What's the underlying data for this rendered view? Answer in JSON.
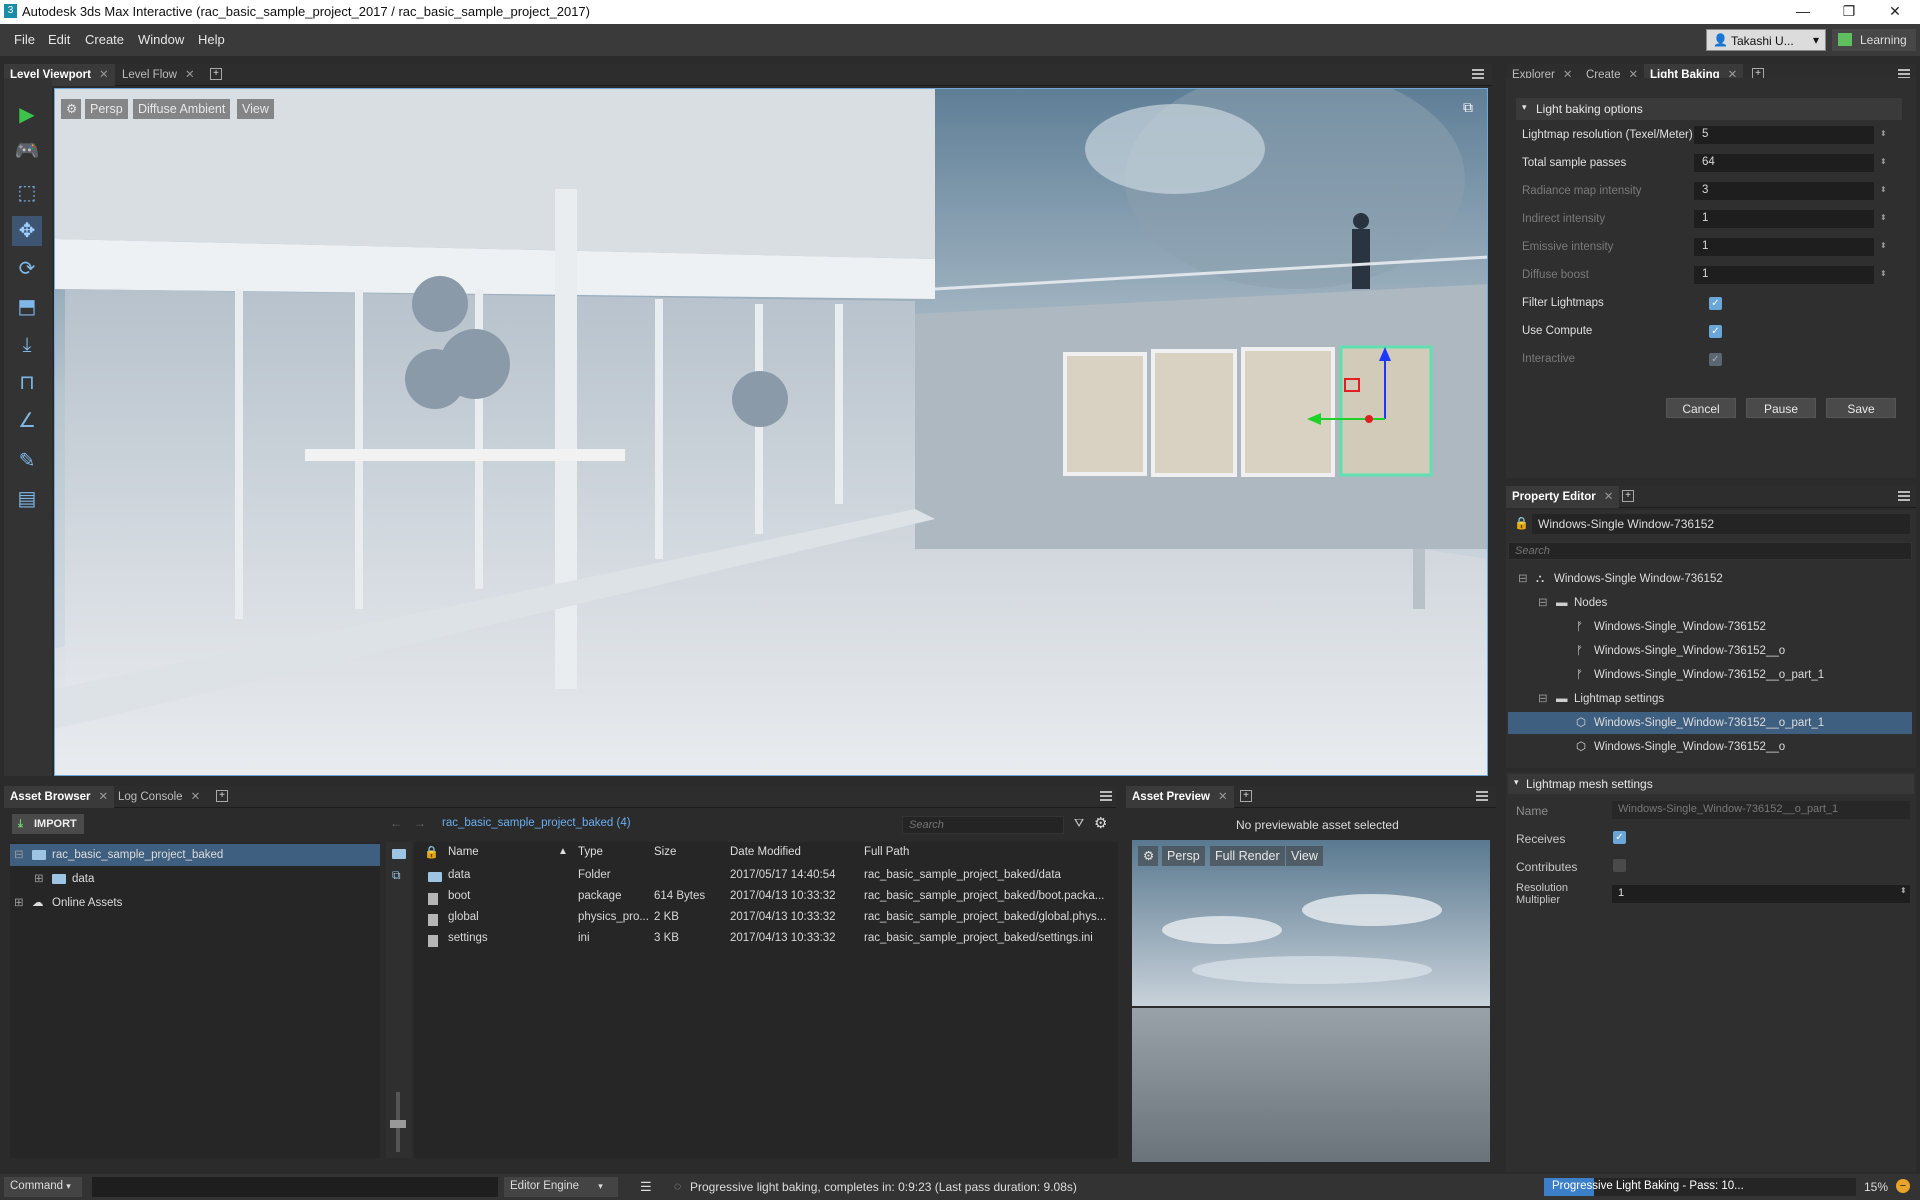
{
  "window": {
    "title": "Autodesk 3ds Max Interactive (rac_basic_sample_project_2017 / rac_basic_sample_project_2017)",
    "minimize": "—",
    "restore": "❐",
    "close": "✕"
  },
  "menu": [
    "File",
    "Edit",
    "Create",
    "Window",
    "Help"
  ],
  "user": {
    "name": "Takashi U...",
    "learning": "Learning"
  },
  "viewport_tabs": [
    {
      "label": "Level Viewport",
      "active": true
    },
    {
      "label": "Level Flow",
      "active": false
    }
  ],
  "viewport": {
    "camera": "Persp",
    "shading": "Diffuse Ambient",
    "view": "View"
  },
  "explorer_tabs": [
    {
      "label": "Explorer",
      "active": false
    },
    {
      "label": "Create",
      "active": false
    },
    {
      "label": "Light Baking",
      "active": true
    }
  ],
  "light_baking": {
    "section": "Light baking options",
    "fields": [
      {
        "label": "Lightmap resolution (Texel/Meter)",
        "value": "5",
        "enabled": true
      },
      {
        "label": "Total sample passes",
        "value": "64",
        "enabled": true
      },
      {
        "label": "Radiance map intensity",
        "value": "3",
        "enabled": false
      },
      {
        "label": "Indirect intensity",
        "value": "1",
        "enabled": false
      },
      {
        "label": "Emissive intensity",
        "value": "1",
        "enabled": false
      },
      {
        "label": "Diffuse boost",
        "value": "1",
        "enabled": false
      }
    ],
    "checks": [
      {
        "label": "Filter Lightmaps",
        "checked": true,
        "enabled": true
      },
      {
        "label": "Use Compute",
        "checked": true,
        "enabled": true
      },
      {
        "label": "Interactive",
        "checked": true,
        "enabled": false
      }
    ],
    "cancel": "Cancel",
    "pause": "Pause",
    "save": "Save"
  },
  "property_editor": {
    "tab": "Property Editor",
    "object_name": "Windows-Single Window-736152",
    "search_placeholder": "Search",
    "tree": [
      {
        "label": "Windows-Single Window-736152",
        "indent": 0,
        "icon": "entity-icon",
        "expand": "⊟"
      },
      {
        "label": "Nodes",
        "indent": 1,
        "icon": "folder-icon",
        "expand": "⊟"
      },
      {
        "label": "Windows-Single_Window-736152",
        "indent": 2,
        "icon": "node-icon"
      },
      {
        "label": "Windows-Single_Window-736152__o",
        "indent": 2,
        "icon": "node-icon"
      },
      {
        "label": "Windows-Single_Window-736152__o_part_1",
        "indent": 2,
        "icon": "node-icon"
      },
      {
        "label": "Lightmap settings",
        "indent": 1,
        "icon": "folder-icon",
        "expand": "⊟"
      },
      {
        "label": "Windows-Single_Window-736152__o_part_1",
        "indent": 2,
        "icon": "mesh-icon",
        "selected": true
      },
      {
        "label": "Windows-Single_Window-736152__o",
        "indent": 2,
        "icon": "mesh-icon"
      }
    ]
  },
  "lightmap_mesh": {
    "section": "Lightmap mesh settings",
    "name_label": "Name",
    "name_value": "Windows-Single_Window-736152__o_part_1",
    "receives_label": "Receives",
    "receives": true,
    "contributes_label": "Contributes",
    "contributes": false,
    "resmult_label_1": "Resolution",
    "resmult_label_2": "Multiplier",
    "resmult_value": "1"
  },
  "asset_tabs": [
    {
      "label": "Asset Browser",
      "active": true
    },
    {
      "label": "Log Console",
      "active": false
    }
  ],
  "asset_browser": {
    "import": "IMPORT",
    "path": "rac_basic_sample_project_baked (4)",
    "search_placeholder": "Search",
    "folders": [
      {
        "label": "rac_basic_sample_project_baked",
        "indent": 0,
        "expand": "⊟",
        "selected": true
      },
      {
        "label": "data",
        "indent": 1,
        "expand": "⊞"
      },
      {
        "label": "Online Assets",
        "indent": 0,
        "expand": "⊞",
        "cloud": true
      }
    ],
    "columns": [
      "Name",
      "Type",
      "Size",
      "Date Modified",
      "Full Path"
    ],
    "files": [
      {
        "name": "data",
        "type": "Folder",
        "size": "",
        "date": "2017/05/17 14:40:54",
        "path": "rac_basic_sample_project_baked/data",
        "folder": true
      },
      {
        "name": "boot",
        "type": "package",
        "size": "614 Bytes",
        "date": "2017/04/13 10:33:32",
        "path": "rac_basic_sample_project_baked/boot.packa..."
      },
      {
        "name": "global",
        "type": "physics_pro...",
        "size": "2 KB",
        "date": "2017/04/13 10:33:32",
        "path": "rac_basic_sample_project_baked/global.phys..."
      },
      {
        "name": "settings",
        "type": "ini",
        "size": "3 KB",
        "date": "2017/04/13 10:33:32",
        "path": "rac_basic_sample_project_baked/settings.ini"
      }
    ]
  },
  "asset_preview": {
    "tab": "Asset Preview",
    "message": "No previewable asset selected",
    "camera": "Persp",
    "render": "Full Render",
    "view": "View"
  },
  "status": {
    "command": "Command",
    "engine": "Editor Engine",
    "message": "Progressive light baking, completes in: 0:9:23 (Last pass duration: 9.08s)",
    "progress_text": "Progressive Light Baking - Pass: 10...",
    "progress_fraction": 0.16,
    "percent": "15%"
  },
  "colors": {
    "accent": "#6aa7d8",
    "selection": "#3f5f80",
    "play": "#3cc24a"
  }
}
